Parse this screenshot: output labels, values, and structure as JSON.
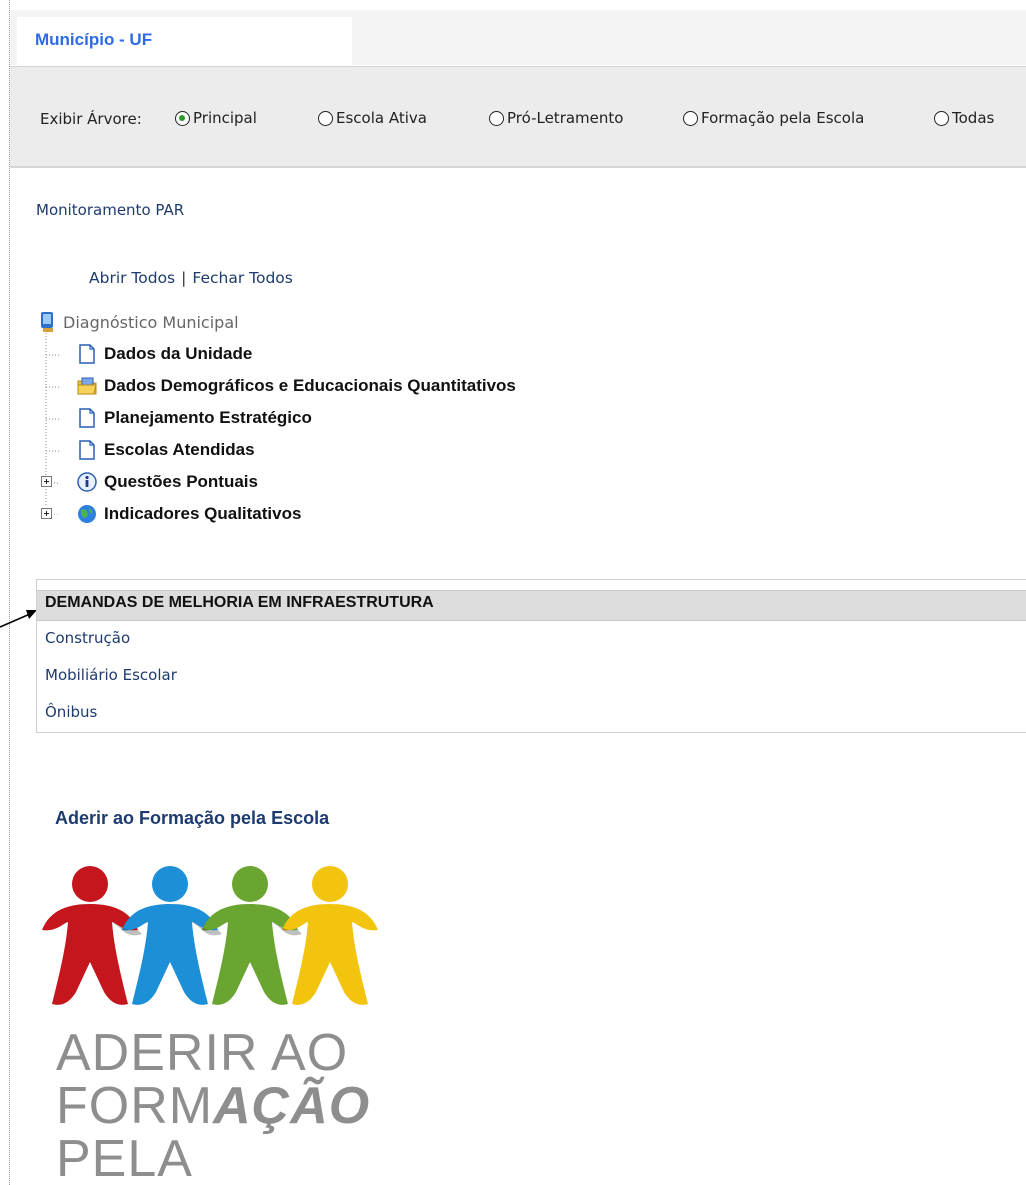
{
  "header": {
    "tab_label": "Município - UF"
  },
  "tree_selector": {
    "label": "Exibir Árvore:",
    "options": [
      {
        "label": "Principal",
        "selected": true
      },
      {
        "label": "Escola Ativa",
        "selected": false
      },
      {
        "label": "Pró-Letramento",
        "selected": false
      },
      {
        "label": "Formação pela Escola",
        "selected": false
      },
      {
        "label": "Todas",
        "selected": false
      }
    ]
  },
  "section_title": "Monitoramento PAR",
  "tree_controls": {
    "open_all": "Abrir Todos",
    "separator": "|",
    "close_all": "Fechar Todos"
  },
  "tree": {
    "root": {
      "label": "Diagnóstico Municipal",
      "icon": "computer-icon"
    },
    "items": [
      {
        "label": "Dados da Unidade",
        "icon": "document-icon"
      },
      {
        "label": "Dados Demográficos e Educacionais Quantitativos",
        "icon": "folder-icon"
      },
      {
        "label": "Planejamento Estratégico",
        "icon": "document-icon"
      },
      {
        "label": "Escolas Atendidas",
        "icon": "document-icon"
      },
      {
        "label": "Questões Pontuais",
        "icon": "info-icon",
        "expandable": true
      },
      {
        "label": "Indicadores Qualitativos",
        "icon": "globe-icon",
        "expandable": true
      }
    ]
  },
  "demands": {
    "title": "DEMANDAS DE MELHORIA EM INFRAESTRUTURA",
    "items": [
      "Construção",
      "Mobiliário Escolar",
      "Ônibus"
    ]
  },
  "adherir": {
    "title": "Aderir ao Formação pela Escola",
    "logo_lines": [
      "ADERIR AO",
      "FORM",
      "AÇÃO",
      "PELA ESCOLA"
    ]
  },
  "colors": {
    "tab_text": "#2e6be6",
    "link": "#1d3b6e",
    "radio_selected": "#2b9b2b",
    "people": [
      "#c4161c",
      "#1d8fd6",
      "#6aa431",
      "#f2c40d"
    ]
  }
}
